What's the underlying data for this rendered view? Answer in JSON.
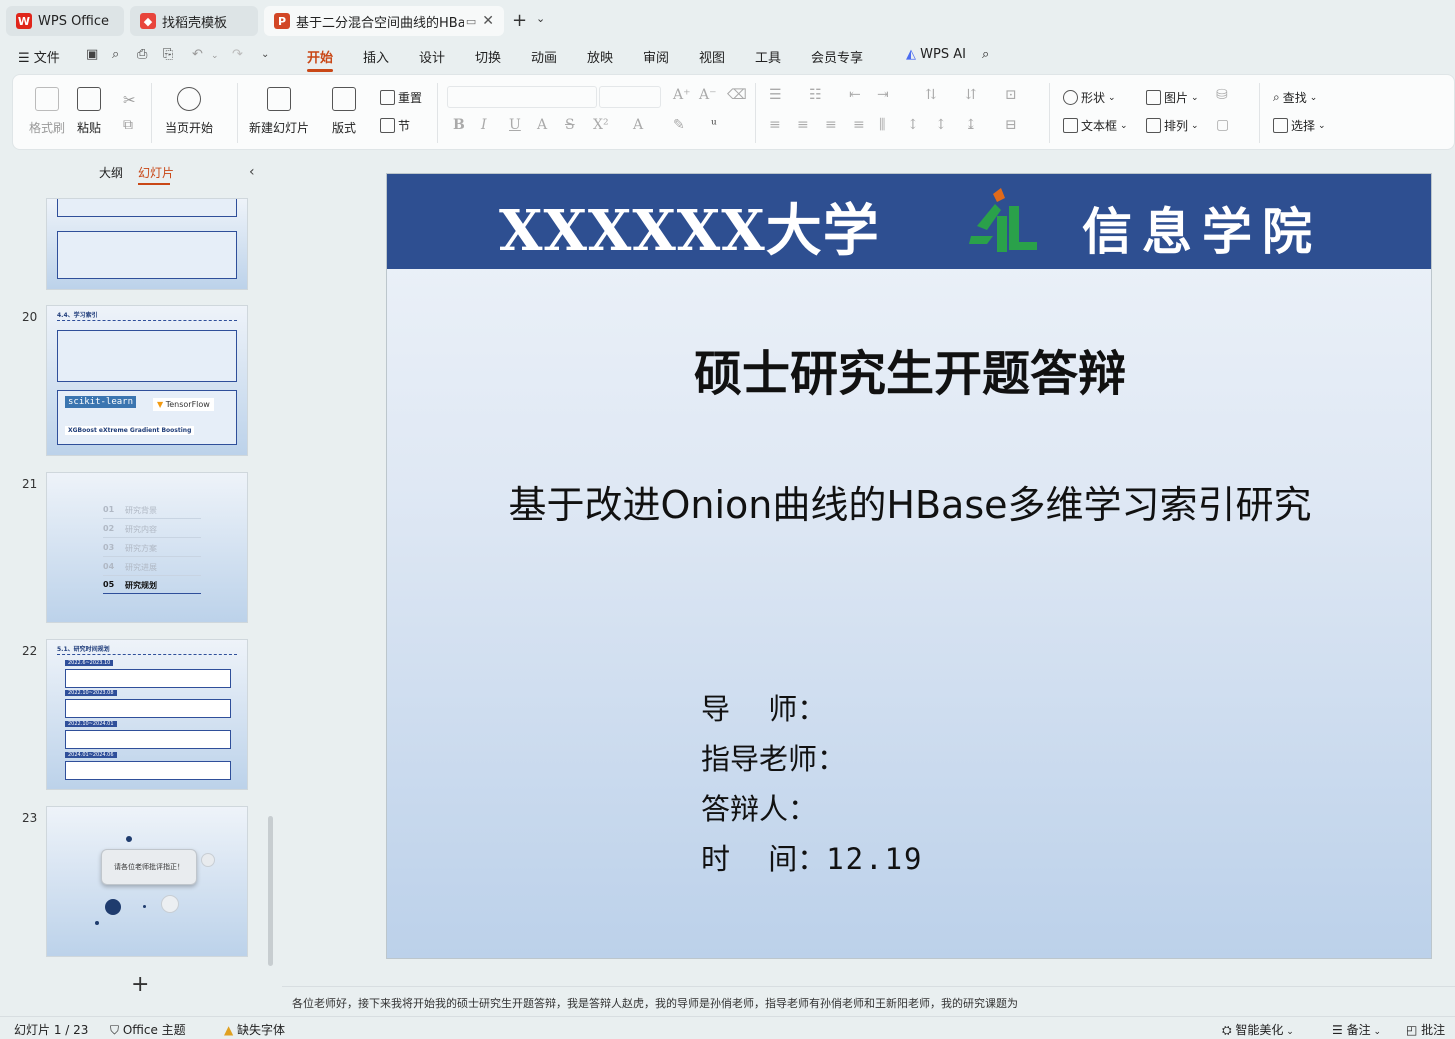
{
  "tabs": [
    {
      "label": "WPS Office",
      "icon": "wps-logo-icon"
    },
    {
      "label": "找稻壳模板",
      "icon": "docer-icon"
    },
    {
      "label": "基于二分混合空间曲线的HBase",
      "icon": "ppt-file-icon",
      "active": true
    }
  ],
  "new_tab_label": "+",
  "menu": {
    "file_label": "文件",
    "items": [
      "开始",
      "插入",
      "设计",
      "切换",
      "动画",
      "放映",
      "审阅",
      "视图",
      "工具",
      "会员专享"
    ],
    "active": "开始",
    "ai_label": "WPS AI"
  },
  "ribbon": {
    "format_painter": "格式刷",
    "paste": "粘贴",
    "from_current": "当页开始",
    "new_slide": "新建幻灯片",
    "layout": "版式",
    "reset": "重置",
    "section": "节",
    "shape": "形状",
    "picture": "图片",
    "find": "查找",
    "textbox": "文本框",
    "arrange": "排列",
    "select": "选择"
  },
  "left_panel": {
    "outline_tab": "大纲",
    "slides_tab": "幻灯片",
    "add_label": "+",
    "thumbnails": [
      {
        "number": "20",
        "heading": "4.4、学习索引",
        "libs": [
          "scikit-learn",
          "TensorFlow",
          "XGBoost eXtreme Gradient Boosting"
        ]
      },
      {
        "number": "21",
        "toc": [
          {
            "num": "01",
            "text": "研究背景"
          },
          {
            "num": "02",
            "text": "研究内容"
          },
          {
            "num": "03",
            "text": "研究方案"
          },
          {
            "num": "04",
            "text": "研究进展"
          },
          {
            "num": "05",
            "text": "研究规划"
          }
        ]
      },
      {
        "number": "22",
        "heading": "5.1、研究时间规划",
        "periods": [
          "2022.6~2023.10",
          "2022.10~2023.08",
          "2022.10~2024.01",
          "2024.01~2024.06"
        ]
      },
      {
        "number": "23",
        "card_text": "请各位老师批评指正！"
      }
    ]
  },
  "slide": {
    "university": "XXXXXX大学",
    "college": "信息学院",
    "title": "硕士研究生开题答辩",
    "subtitle": "基于改进Onion曲线的HBase多维学习索引研究",
    "info": [
      {
        "label": "导　 师：",
        "value": ""
      },
      {
        "label": "指导老师：",
        "value": ""
      },
      {
        "label": "答辩人：",
        "value": ""
      },
      {
        "label": "时　 间：",
        "value": "12.19"
      }
    ],
    "header_color": "#2e4f91"
  },
  "notes_text": "各位老师好，接下来我将开始我的硕士研究生开题答辩，我是答辩人赵虎，我的导师是孙俏老师，指导老师有孙俏老师和王新阳老师，我的研究课题为",
  "status": {
    "slide_counter": "幻灯片 1 / 23",
    "theme": "Office 主题",
    "missing_font": "缺失字体",
    "smart_beautify": "智能美化",
    "notes": "备注",
    "comments": "批注"
  },
  "colors": {
    "accent": "#c94716",
    "slide_header": "#2e4f91"
  }
}
